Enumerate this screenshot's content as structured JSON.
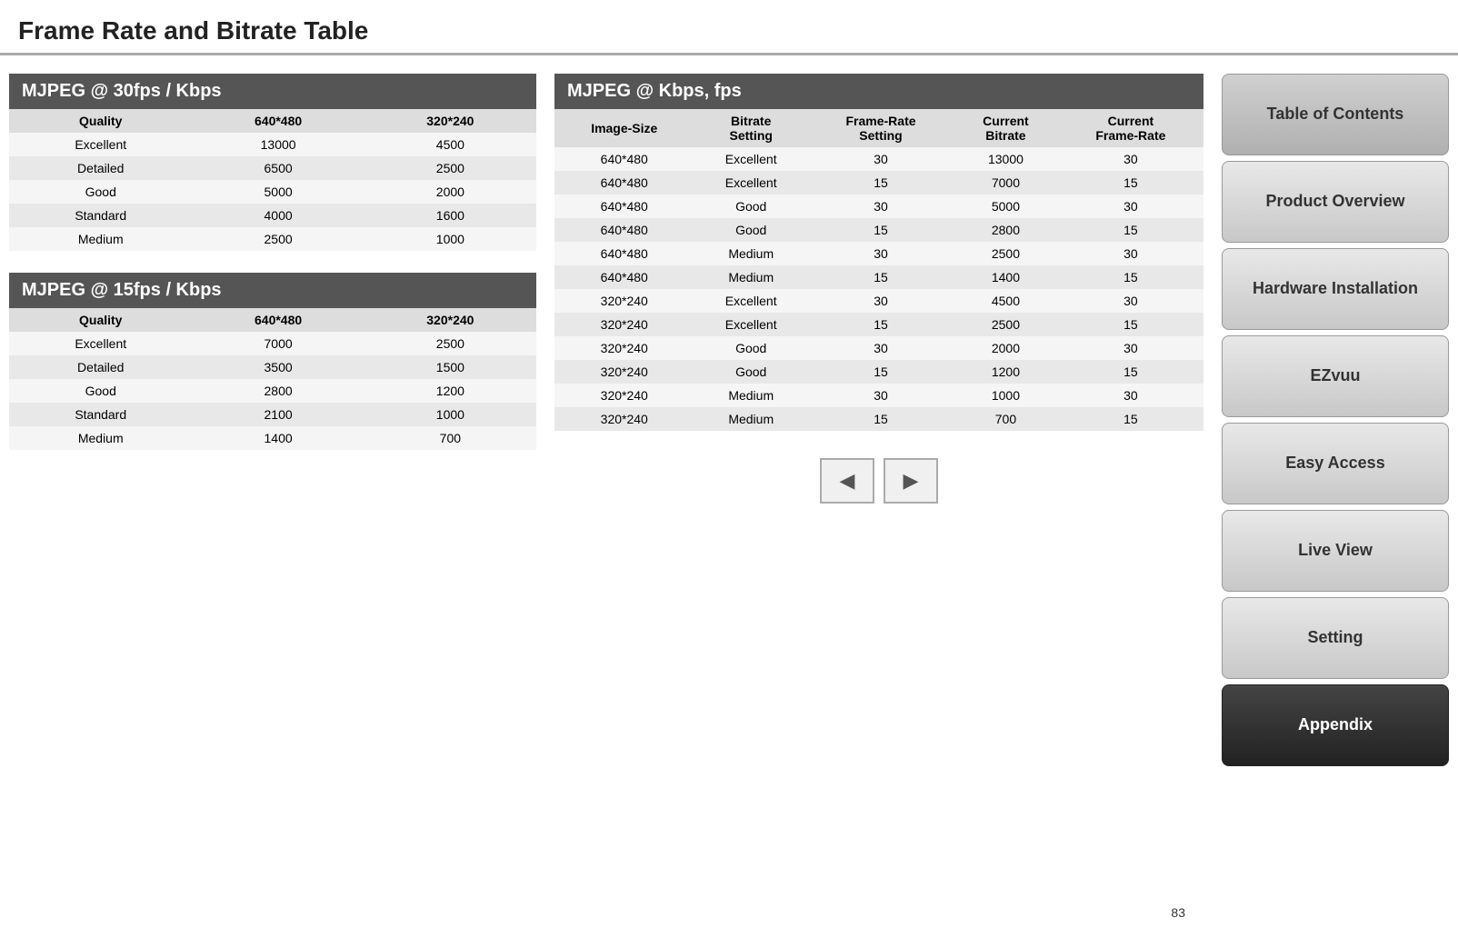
{
  "page": {
    "title": "Frame Rate and Bitrate Table",
    "page_number": "83"
  },
  "left_section1": {
    "header": "MJPEG @ 30fps / Kbps",
    "columns": [
      "Quality",
      "640*480",
      "320*240"
    ],
    "rows": [
      [
        "Excellent",
        "13000",
        "4500"
      ],
      [
        "Detailed",
        "6500",
        "2500"
      ],
      [
        "Good",
        "5000",
        "2000"
      ],
      [
        "Standard",
        "4000",
        "1600"
      ],
      [
        "Medium",
        "2500",
        "1000"
      ]
    ]
  },
  "left_section2": {
    "header": "MJPEG @ 15fps / Kbps",
    "columns": [
      "Quality",
      "640*480",
      "320*240"
    ],
    "rows": [
      [
        "Excellent",
        "7000",
        "2500"
      ],
      [
        "Detailed",
        "3500",
        "1500"
      ],
      [
        "Good",
        "2800",
        "1200"
      ],
      [
        "Standard",
        "2100",
        "1000"
      ],
      [
        "Medium",
        "1400",
        "700"
      ]
    ]
  },
  "right_section": {
    "header": "MJPEG @ Kbps, fps",
    "columns": [
      "Image-Size",
      "Bitrate Setting",
      "Frame-Rate Setting",
      "Current Bitrate",
      "Current Frame-Rate"
    ],
    "rows": [
      [
        "640*480",
        "Excellent",
        "30",
        "13000",
        "30"
      ],
      [
        "640*480",
        "Excellent",
        "15",
        "7000",
        "15"
      ],
      [
        "640*480",
        "Good",
        "30",
        "5000",
        "30"
      ],
      [
        "640*480",
        "Good",
        "15",
        "2800",
        "15"
      ],
      [
        "640*480",
        "Medium",
        "30",
        "2500",
        "30"
      ],
      [
        "640*480",
        "Medium",
        "15",
        "1400",
        "15"
      ],
      [
        "320*240",
        "Excellent",
        "30",
        "4500",
        "30"
      ],
      [
        "320*240",
        "Excellent",
        "15",
        "2500",
        "15"
      ],
      [
        "320*240",
        "Good",
        "30",
        "2000",
        "30"
      ],
      [
        "320*240",
        "Good",
        "15",
        "1200",
        "15"
      ],
      [
        "320*240",
        "Medium",
        "30",
        "1000",
        "30"
      ],
      [
        "320*240",
        "Medium",
        "15",
        "700",
        "15"
      ]
    ]
  },
  "sidebar": {
    "items": [
      {
        "id": "toc",
        "label": "Table of\nContents",
        "active": false,
        "class": "toc"
      },
      {
        "id": "product-overview",
        "label": "Product\nOverview",
        "active": false,
        "class": ""
      },
      {
        "id": "hardware-installation",
        "label": "Hardware\nInstallation",
        "active": false,
        "class": ""
      },
      {
        "id": "ezvuu",
        "label": "EZvuu",
        "active": false,
        "class": ""
      },
      {
        "id": "easy-access",
        "label": "Easy Access",
        "active": false,
        "class": ""
      },
      {
        "id": "live-view",
        "label": "Live View",
        "active": false,
        "class": ""
      },
      {
        "id": "setting",
        "label": "Setting",
        "active": false,
        "class": ""
      },
      {
        "id": "appendix",
        "label": "Appendix",
        "active": true,
        "class": "active"
      }
    ]
  },
  "nav": {
    "prev_label": "◀",
    "next_label": "▶"
  }
}
